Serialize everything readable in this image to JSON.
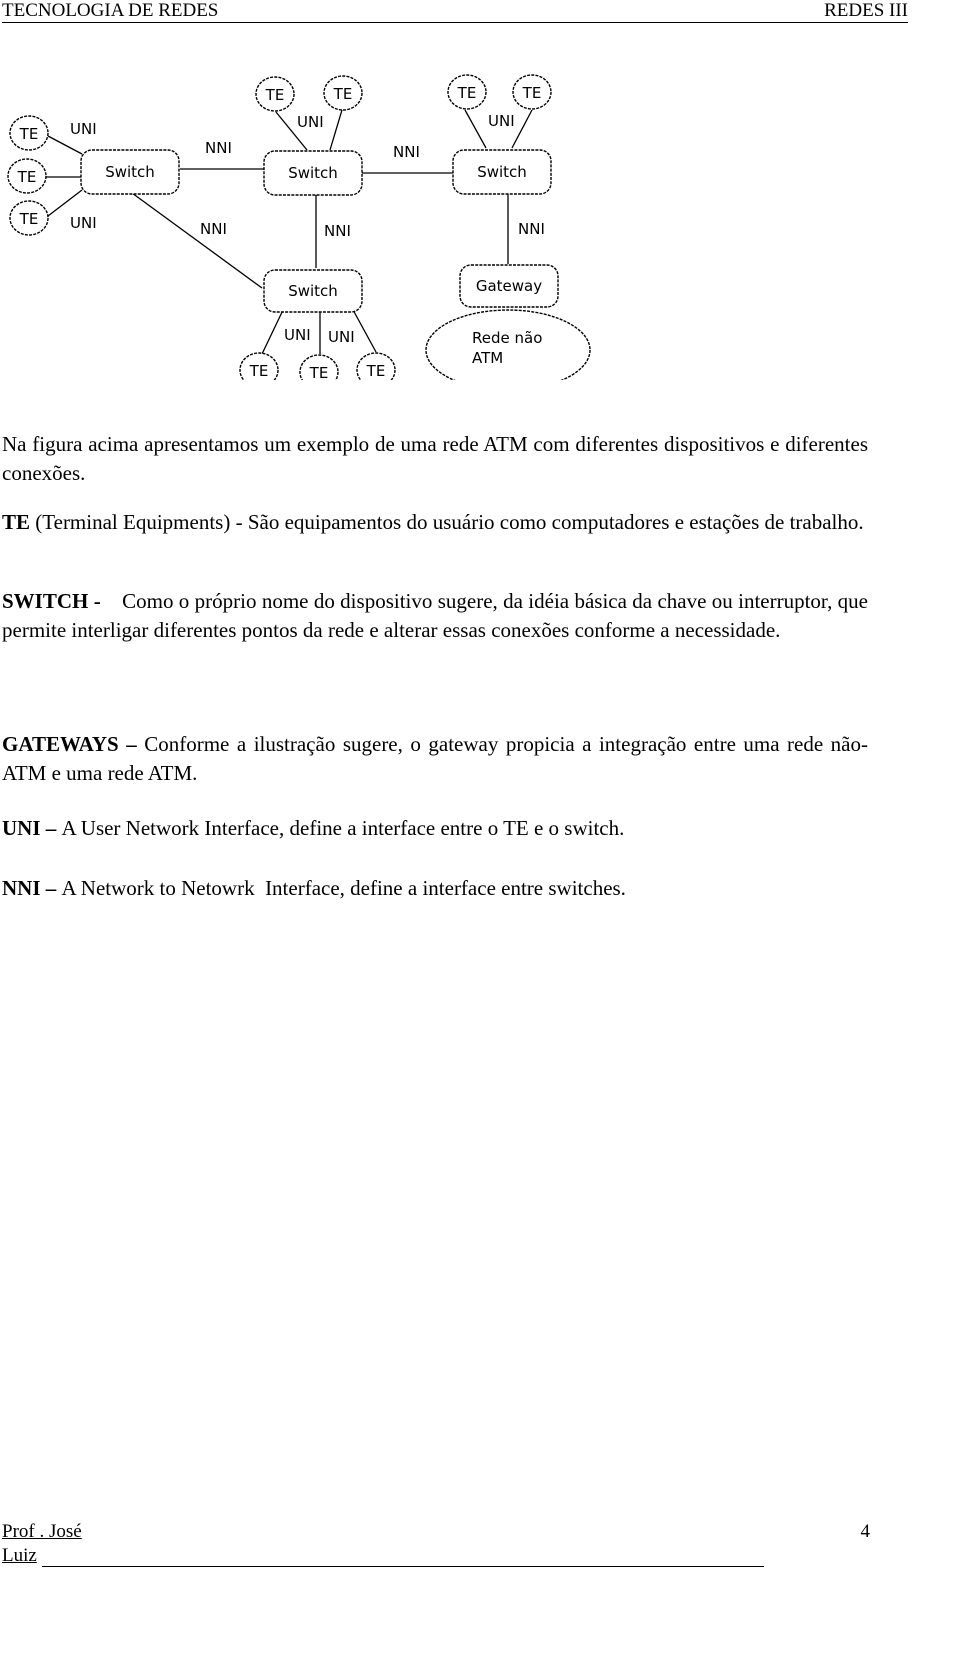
{
  "header": {
    "left": "TECNOLOGIA DE REDES",
    "right": "REDES III"
  },
  "diagram": {
    "te_label": "TE",
    "switch_label": "Switch",
    "gateway_label": "Gateway",
    "uni_label": "UNI",
    "nni_label": "NNI",
    "non_atm_line1": "Rede não",
    "non_atm_line2": "ATM"
  },
  "paragraphs": [
    {
      "term": "",
      "text": "Na figura acima  apresentamos um exemplo de uma rede ATM com diferentes dispositivos e diferentes conexões."
    },
    {
      "term": "TE",
      "text": " (Terminal Equipments) - São  equipamentos  do  usuário  como  computadores  e estações de trabalho."
    },
    {
      "term": "SWITCH - ",
      "text": "   Como o próprio nome do dispositivo sugere, da idéia básica da chave ou interruptor, que permite interligar diferentes pontos da rede e alterar essas conexões conforme a necessidade."
    },
    {
      "term": "GATEWAYS – ",
      "text": "Conforme a ilustração sugere, o gateway propicia a integração entre uma rede não-ATM e uma rede ATM."
    },
    {
      "term": "UNI – ",
      "text": "A User Network Interface, define a interface entre o TE e o switch."
    },
    {
      "term": "NNI – ",
      "text": "A Network to Netowrk  Interface, define a interface entre switches."
    }
  ],
  "footer": {
    "author_line1": "Prof . José",
    "author_line2": "Luiz",
    "page_number": "4"
  }
}
